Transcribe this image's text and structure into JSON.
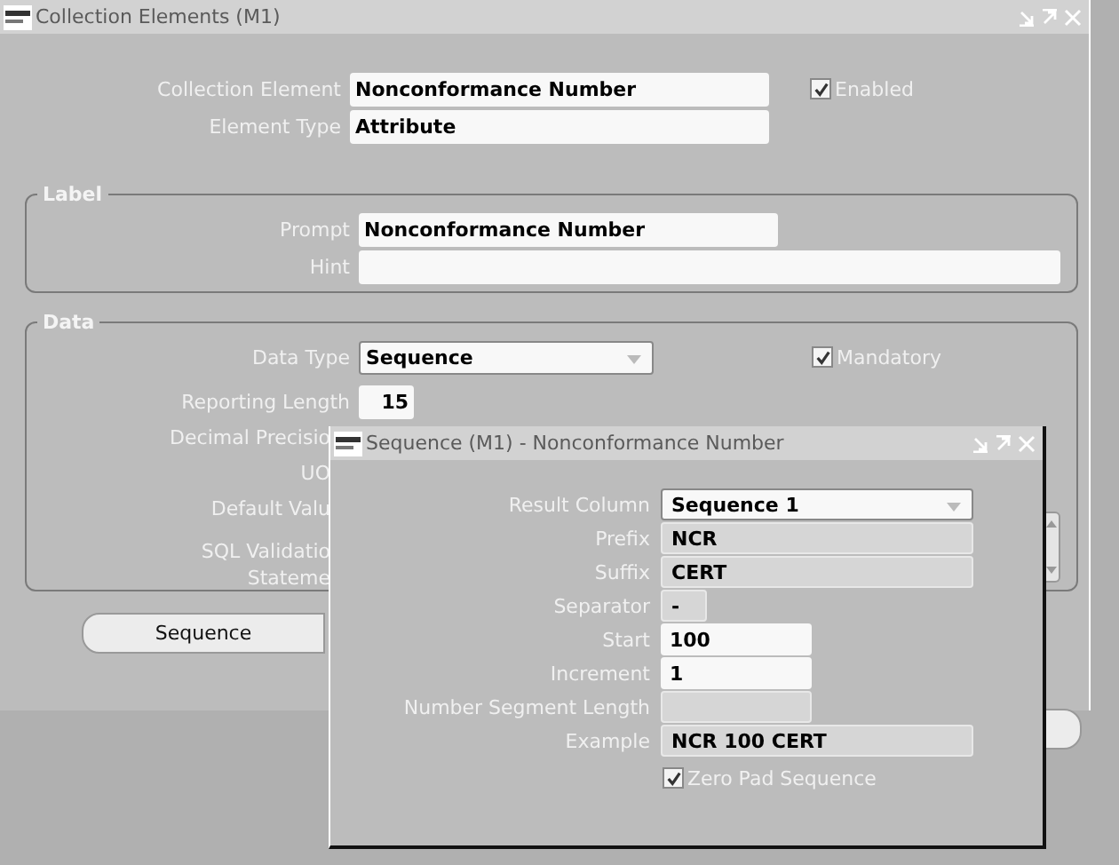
{
  "main_window": {
    "title": "Collection Elements (M1)",
    "collection_element": {
      "label": "Collection Element",
      "value": "Nonconformance Number"
    },
    "enabled": {
      "label": "Enabled",
      "checked": true
    },
    "element_type": {
      "label": "Element Type",
      "value": "Attribute"
    },
    "label_group": {
      "title": "Label",
      "prompt": {
        "label": "Prompt",
        "value": "Nonconformance Number"
      },
      "hint": {
        "label": "Hint"
      }
    },
    "data_group": {
      "title": "Data",
      "data_type": {
        "label": "Data Type",
        "value": "Sequence"
      },
      "mandatory": {
        "label": "Mandatory",
        "checked": true
      },
      "reporting_length": {
        "label": "Reporting Length",
        "value": "15"
      },
      "cut_labels": [
        {
          "text": "Decimal Precisio"
        },
        {
          "text": "UO"
        },
        {
          "text": "Default Valu"
        },
        {
          "text": "SQL Validatio\nStateme"
        }
      ]
    },
    "buttons": [
      {
        "label": "Sequence"
      }
    ]
  },
  "sequence_window": {
    "title": "Sequence (M1) - Nonconformance Number",
    "rows": [
      {
        "label": "Result Column",
        "kind": "dropdown",
        "value": "Sequence 1",
        "disabled": false
      },
      {
        "label": "Prefix",
        "kind": "text",
        "value": "NCR",
        "disabled": true
      },
      {
        "label": "Suffix",
        "kind": "text",
        "value": "CERT",
        "disabled": true
      },
      {
        "label": "Separator",
        "kind": "text",
        "value": "-",
        "disabled": true
      },
      {
        "label": "Start",
        "kind": "text",
        "value": "100",
        "disabled": false
      },
      {
        "label": "Increment",
        "kind": "text",
        "value": "1",
        "disabled": false
      },
      {
        "label": "Number Segment Length",
        "kind": "text",
        "disabled": true
      },
      {
        "label": "Example",
        "kind": "text",
        "value": "NCR 100 CERT",
        "disabled": true
      }
    ],
    "zero_pad": {
      "label": "Zero Pad Sequence",
      "checked": true
    }
  }
}
